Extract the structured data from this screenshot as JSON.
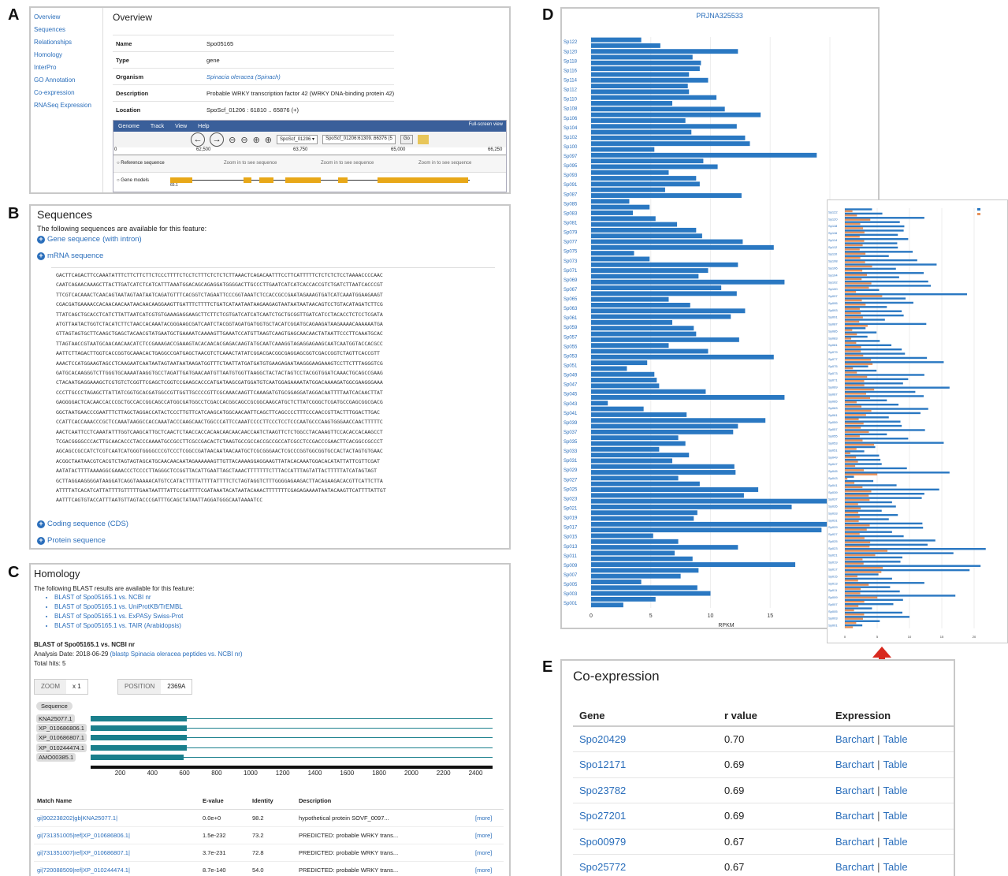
{
  "labels": {
    "a": "A",
    "b": "B",
    "c": "C",
    "d": "D",
    "e": "E"
  },
  "panel_a": {
    "sidebar": [
      "Overview",
      "Sequences",
      "Relationships",
      "Homology",
      "InterPro",
      "GO Annotation",
      "Co-expression",
      "RNASeq Expression"
    ],
    "title": "Overview",
    "rows": [
      {
        "key": "Name",
        "value": "Spo05165"
      },
      {
        "key": "Type",
        "value": "gene"
      },
      {
        "key": "Organism",
        "value": "Spinacia oleracea (Spinach)"
      },
      {
        "key": "Description",
        "value": "Probable WRKY transcription factor 42 (WRKY DNA-binding protein 42)"
      },
      {
        "key": "Location",
        "value": "SpoScf_01206 : 61810 .. 65876 (+)"
      }
    ],
    "browser": {
      "menu": [
        "Genome",
        "Track",
        "View",
        "Help"
      ],
      "fullscreen": "Full-screen view",
      "ref_select": "SpoScf_01206",
      "loc_input": "SpoScf_01206:61309..66376 (5",
      "go": "Go",
      "ruler": [
        "0",
        "62,500",
        "63,750",
        "65,000",
        "66,250"
      ],
      "ref_track": "Reference sequence",
      "zoom_msg": "Zoom in to see sequence",
      "gene_track": "Gene models",
      "gene_label": "65.1"
    }
  },
  "panel_b": {
    "title": "Sequences",
    "intro": "The following sequences are available for this feature:",
    "gene_seq": "Gene sequence",
    "gene_seq_note": "(with intron)",
    "mrna": "mRNA sequence",
    "sequence": [
      "GACTTCAGACTTCCAAATATTTCTTCTTCTTCTCCCTTTTCTCCTCTTTCTCTCTCTTAAACTCAGACAATTTCCTTCATTTTTCTCTCTCTCCTAAAACCCCAAC",
      "CAATCAGAACAAAGCTTACTTGATCATCTCATCATTTAAATGGACAGCAGAGGATGGGGACTTGCCCTTGAATCATCATCACCACCGTCTGATCTTAATCACCCGT",
      "TTCGTCACAAACTCAACAGTAATAGTAATAATCAGATGTTTCACGGTCTAGAATTCCCGGTAAATCTCCACCGCCGAATAGAAAGTGATCATCAAATGGAAGAAGT",
      "CGACGATGAAAACCACAACAACAATAACAACAAGGAAGTTGATTTCTTTTCTGATCATAATAATAAGAAGAGTAATAATAATAACAGTCCTGTACATAGATCTTCG",
      "TTATCAGCTGCACCTCATCTTATTAATCATCGTGTGAAAGAGGAAGCTTCTTCTCGTGATCATCATCAATCTGCTGCGGTTGATCATCCTACACCTCTCCTCGATA",
      "ATGTTAATACTGGTCTACATCTTCTAACCACAAATACGGGAAGCGATCAATCTACGGTAGATGATGGTGCTACATCGGATGCAGAAGATAAGAAAACAAAAAATGA",
      "GTTAGTAGTGCTTCAAGCTGAGCTACAACGTATGAATGCTGAAAATCAAAAGTTGAAATCCATGTTAAGTCAAGTGAGCAACAACTATAATTCCCTTCAAATGCAC",
      "TTAGTAACCGTAATGCAACAACAACATCTCCGAAAGACCGAAAGTACACAACACGAGACAAGTATGCAATCAAAGGTAGAGGAGAAGCAATCAATGGTACCACGCC",
      "AATTCTTAGACTTGGTCACCGGTGCAAACACTGAGGCCGATGAGCTAACGTCTCAAACTATATCGGACGACGGCGAGGAGCGGTCGACCGGTCTAGTTCACCGTT",
      "AAACTCCATGGAAGTAGCCTCAAGAATCAATAATAGTAATAATAAGATGGTTTCTAATTATGATGATGTGAAGAGAATAAGGGAAGAAAGTCCTTCTTTAGGGTCG",
      "GATGCACAAGGGTCTTGGGTGCAAAATAAGGTGCCTAGATTGATGAACAATGTTAATGTGGTTAAGGCTACTACTAGTCCTACGGTGGATCAAACTGCAGCCGAAG",
      "CTACAATGAGGAAAGCTCGTGTCTCGGTTCGAGCTCGGTCCGAAGCACCCATGATAAGCGATGGATGTCAATGGAGAAAATATGGACAAAAGATGGCGAAGGGAAA",
      "CCCTTGCCCTAGAGCTTATTATCGGTGCACGATGGCCGTTGGTTGCCCCGTTCGCAAACAAGTTCAAAGATGTGCGGAGGATAGGACAATTTTAATCACAACTTAT",
      "GAGGGGACTCACAACCACCCGCTGCCACCGGCAGCCATGGCGATGGCCTCGACCACGGCAGCCGCGGCAAGCATGCTCTTATCGGGCTCGATGCCGAGCGGCGACG",
      "GGCTAATGAACCCGAATTTCTTAGCTAGGACCATACTCCCTTGTTCATCAAGCATGGCAACAATTCAGCTTCAGCCCCTTTCCCAACCGTTACTTTGGACTTGAC",
      "CCATTCACCAAACCCGCTCCAAATAAGGCCACCAAATACCCAAGCAACTGGCCCATTCCAAATCCCCTTCCCTCCTCCCAATGCCCAAGTGGGAACCAACTTTTTC",
      "AACTCAATTCCTCAAATATTTGGTCAAGCATTGCTCAACTCTAACCACCACAACAACAACAACCAATCTAAGTTCTCTGGCCTACAAAGTTCCACACCACAAGCCT",
      "TCGACGGGGCCCACTTGCAACACCCTACCCAAAATGCCGCCTTCGCCGACACTCTAAGTGCCGCCACCGCCGCCATCGCCTCCGACCCGAACTTCACGGCCGCCCT",
      "AGCAGCCGCCATCTCGTCAATCATGGGTGGGGCCCGTCCCTCGGCCGATAACAATAACAATGCTCGCGGGAACTCGCCCGGTGGCGGTGCCACTACTAGTGTGAAC",
      "ACGGCTAATAACGTCACGTCTAGTAGTAGCATGCAACAACAATAGAAAAAAGTTGTTACAAAAGGAGGAAGTTATACACAAATGGACACATATTATTCGTTCGAT",
      "AATATACTTTTAAAAGGCGAAACCCTCCCCTTAGGGCTCCGGTTACATTGAATTAGCTAAACTTTTTTTCTTTACCATTTAGTATTACTTTTTATCATAGTAGT",
      "GCTTAGGAAGGGGATAAGGATCAGGTAAAAACATGTCCATACTTTTATTTTATTTTCTCTAGTAGGTCTTTGGGGAGAAGACTTACAGAAGACACGTTCATTCTTA",
      "ATTTTATCACATCATTATTTTGTTTTTGAATAATTTATTCCGATTTTCGATAAATACATAATACAAACTTTTTTTCGAGAGAAAATAATACAAGTTCATTTTATTGT",
      "AATTTCAGTGTACCATTTAATGTTAGTACCCGATTTGCAGCTATAATTAGGATGGGCAATAAAATCC"
    ],
    "cds": "Coding sequence (CDS)",
    "protein": "Protein sequence"
  },
  "panel_c": {
    "title": "Homology",
    "intro": "The following BLAST results are available for this feature:",
    "links": [
      "BLAST of Spo05165.1 vs. NCBI nr",
      "BLAST of Spo05165.1 vs. UniProtKB/TrEMBL",
      "BLAST of Spo05165.1 vs. ExPASy Swiss-Prot",
      "BLAST of Spo05165.1 vs. TAIR (Arabidopsis)"
    ],
    "blast_head": "BLAST of Spo05165.1 vs. NCBI nr",
    "analysis_label": "Analysis Date: 2018-06-29",
    "analysis_link": "(blastp Spinacia oleracea peptides vs. NCBI nr)",
    "total_hits": "Total hits: 5",
    "zoom_key": "ZOOM",
    "zoom_val": "x 1",
    "pos_key": "POSITION",
    "pos_val": "2369A",
    "seq_label": "Sequence",
    "hits": [
      {
        "name": "KNA25077.1",
        "end": 600
      },
      {
        "name": "XP_010686806.1",
        "end": 600
      },
      {
        "name": "XP_010686807.1",
        "end": 600
      },
      {
        "name": "XP_010244474.1",
        "end": 600
      },
      {
        "name": "AMO00385.1",
        "end": 580
      }
    ],
    "axis": [
      "200",
      "400",
      "600",
      "800",
      "1000",
      "1200",
      "1400",
      "1600",
      "1800",
      "2000",
      "2200",
      "2400"
    ],
    "cols": [
      "Match Name",
      "E-value",
      "Identity",
      "Description",
      ""
    ],
    "rows": [
      [
        "gi|902238202|gb|KNA25077.1|",
        "0.0e+0",
        "98.2",
        "hypothetical protein SOVF_0097...",
        "[more]"
      ],
      [
        "gi|731351005|ref|XP_010686806.1|",
        "1.5e-232",
        "73.2",
        "PREDICTED: probable WRKY trans...",
        "[more]"
      ],
      [
        "gi|731351007|ref|XP_010686807.1|",
        "3.7e-231",
        "72.8",
        "PREDICTED: probable WRKY trans...",
        "[more]"
      ],
      [
        "gi|720088509|ref|XP_010244474.1|",
        "8.7e-140",
        "54.0",
        "PREDICTED: probable WRKY trans...",
        "[more]"
      ]
    ]
  },
  "chart_data": [
    {
      "type": "bar",
      "title": "PRJNA325533",
      "xlabel": "RPKM",
      "xlim": [
        0,
        20
      ],
      "xticks": [
        "0",
        "5",
        "10",
        "15",
        "20"
      ],
      "categories": [
        "Sp122",
        "Sp120",
        "Sp118",
        "Sp116",
        "Sp114",
        "Sp112",
        "Sp110",
        "Sp108",
        "Sp106",
        "Sp104",
        "Sp102",
        "Sp100",
        "Sp097",
        "Sp095",
        "Sp093",
        "Sp091",
        "Sp087",
        "Sp085",
        "Sp083",
        "Sp081",
        "Sp079",
        "Sp077",
        "Sp075",
        "Sp073",
        "Sp071",
        "Sp069",
        "Sp067",
        "Sp065",
        "Sp063",
        "Sp061",
        "Sp059",
        "Sp057",
        "Sp055",
        "Sp053",
        "Sp051",
        "Sp049",
        "Sp047",
        "Sp045",
        "Sp043",
        "Sp041",
        "Sp039",
        "Sp037",
        "Sp035",
        "Sp033",
        "Sp031",
        "Sp029",
        "Sp027",
        "Sp025",
        "Sp023",
        "Sp021",
        "Sp019",
        "Sp017",
        "Sp015",
        "Sp013",
        "Sp011",
        "Sp009",
        "Sp007",
        "Sp005",
        "Sp003",
        "Sp001"
      ],
      "values": [
        [
          4.2,
          5.8
        ],
        [
          12.3,
          8.5,
          9.2
        ],
        [
          9.1,
          8.2,
          9.8
        ],
        [
          8.1,
          8.2,
          10.5
        ],
        [
          6.8,
          11.2,
          14.2
        ],
        [
          7.9,
          12.2,
          8.4
        ],
        [
          12.9,
          13.3,
          5.3
        ],
        [
          18.9,
          9.4,
          10.6
        ],
        [
          6.5,
          8.8,
          9.1
        ],
        [
          6.2,
          12.6,
          3.2
        ],
        [
          4.9,
          3.5,
          5.4
        ],
        [
          7.2,
          8.8,
          9.3
        ],
        [
          12.7,
          15.3,
          3.6
        ],
        [
          4.9,
          12.3,
          9.8
        ],
        [
          9.0,
          16.2,
          10.9
        ],
        [
          12.2,
          6.5,
          8.3
        ],
        [
          12.9,
          11.7,
          6.8
        ],
        [
          8.6,
          8.8,
          12.4
        ],
        [
          6.5,
          9.8,
          15.3
        ],
        [
          4.7,
          3.0,
          5.3
        ],
        [
          5.5,
          5.7,
          9.6
        ],
        [
          16.2,
          1.4,
          4.4
        ],
        [
          8.0,
          14.6,
          12.3
        ],
        [
          11.9,
          7.3,
          7.9
        ],
        [
          5.7,
          8.2,
          6.8
        ],
        [
          12.0,
          12.1,
          7.3
        ],
        [
          9.1,
          14.0,
          12.8
        ],
        [
          21.8,
          16.8,
          8.9
        ],
        [
          8.6,
          21.0,
          19.3
        ],
        [
          5.2,
          7.3
        ],
        [
          12.3,
          7.0,
          8.5
        ],
        [
          17.1,
          9.0,
          7.5
        ],
        [
          4.2,
          8.9,
          10.0
        ],
        [
          5.4,
          2.7
        ]
      ],
      "series": [
        {
          "name": "",
          "values": []
        }
      ]
    }
  ],
  "panel_e": {
    "title": "Co-expression",
    "cols": [
      "Gene",
      "r value",
      "Expression"
    ],
    "rows": [
      [
        "Spo20429",
        "0.70"
      ],
      [
        "Spo12171",
        "0.69"
      ],
      [
        "Spo23782",
        "0.69"
      ],
      [
        "Spo27201",
        "0.69"
      ],
      [
        "Spo00979",
        "0.67"
      ],
      [
        "Spo25772",
        "0.67"
      ]
    ],
    "barchart": "Barchart",
    "sep": "|",
    "table": "Table"
  },
  "colors": {
    "bar": "#2a78c2",
    "orange": "#e8925a",
    "teal": "#1a7f8c",
    "arrow": "#d8291e",
    "link": "#2a6ebb"
  }
}
